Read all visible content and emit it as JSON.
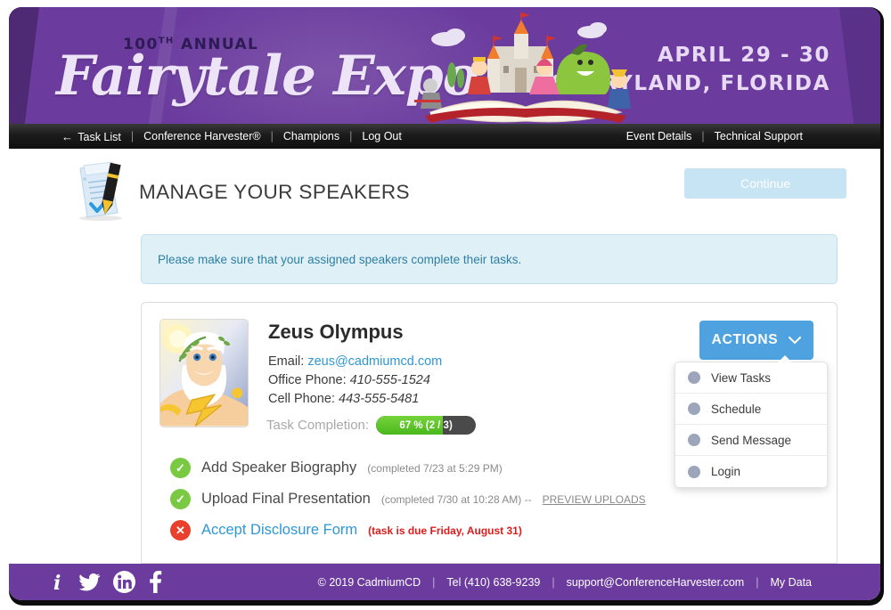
{
  "banner": {
    "annual_prefix": "100",
    "annual_sup": "TH",
    "annual_suffix": " ANNUAL",
    "title": "Fairytale Expo",
    "date_line1": "APRIL 29 - 30",
    "date_line2": "STORYLAND, FLORIDA",
    "brand_purple": "#6b3c9e"
  },
  "nav": {
    "back_arrow": "←",
    "left_items": [
      {
        "label": "Task List"
      },
      {
        "label": "Conference Harvester®"
      },
      {
        "label": "Champions"
      },
      {
        "label": "Log Out"
      }
    ],
    "right_items": [
      {
        "label": "Event Details"
      },
      {
        "label": "Technical Support"
      }
    ],
    "separator": "|"
  },
  "header": {
    "page_title": "MANAGE YOUR SPEAKERS",
    "continue_label": "Continue",
    "continue_color": "#c7e4f5"
  },
  "notice": {
    "text": "Please make sure that your assigned speakers complete their tasks.",
    "bg": "#dff0f7",
    "text_color": "#2e7fa3"
  },
  "speaker": {
    "name": "Zeus Olympus",
    "email_label": "Email:",
    "email": "zeus@cadmiumcd.com",
    "office_label": "Office Phone:",
    "office_phone": "410-555-1524",
    "cell_label": "Cell Phone:",
    "cell_phone": "443-555-5481",
    "completion_label": "Task Completion:",
    "completion_text": "67 % (2 / 3)",
    "completion_percent": 67,
    "completion_done": 2,
    "completion_total": 3,
    "progress_fill_color": "#5cc425",
    "progress_track_color": "#4a4a4a",
    "actions_label": "ACTIONS",
    "actions_chevron": "⌄",
    "actions_color": "#4ea2e0"
  },
  "dropdown": {
    "items": [
      {
        "label": "View Tasks",
        "icon": "bullet-icon"
      },
      {
        "label": "Schedule",
        "icon": "bullet-icon"
      },
      {
        "label": "Send Message",
        "icon": "bullet-icon"
      },
      {
        "label": "Login",
        "icon": "bullet-icon"
      }
    ]
  },
  "tasks": [
    {
      "status": "complete",
      "badge": "✓",
      "name": "Add Speaker Biography",
      "meta": "(completed 7/23 at 5:29 PM)",
      "preview": "",
      "due": ""
    },
    {
      "status": "complete",
      "badge": "✓",
      "name": "Upload Final Presentation",
      "meta": "(completed 7/30 at 10:28 AM) --",
      "preview": "PREVIEW UPLOADS",
      "due": ""
    },
    {
      "status": "incomplete",
      "badge": "✕",
      "name": "Accept Disclosure Form",
      "meta": "",
      "preview": "",
      "due": "(task is due Friday, August 31)"
    }
  ],
  "footer": {
    "social": [
      {
        "name": "info-icon",
        "glyph": "i"
      },
      {
        "name": "twitter-icon",
        "glyph": "twitter"
      },
      {
        "name": "linkedin-icon",
        "glyph": "in"
      },
      {
        "name": "facebook-icon",
        "glyph": "f"
      }
    ],
    "copyright": "© 2019 CadmiumCD",
    "tel": "Tel (410) 638-9239",
    "support_email": "support@ConferenceHarvester.com",
    "my_data": "My Data",
    "separator": "|"
  }
}
